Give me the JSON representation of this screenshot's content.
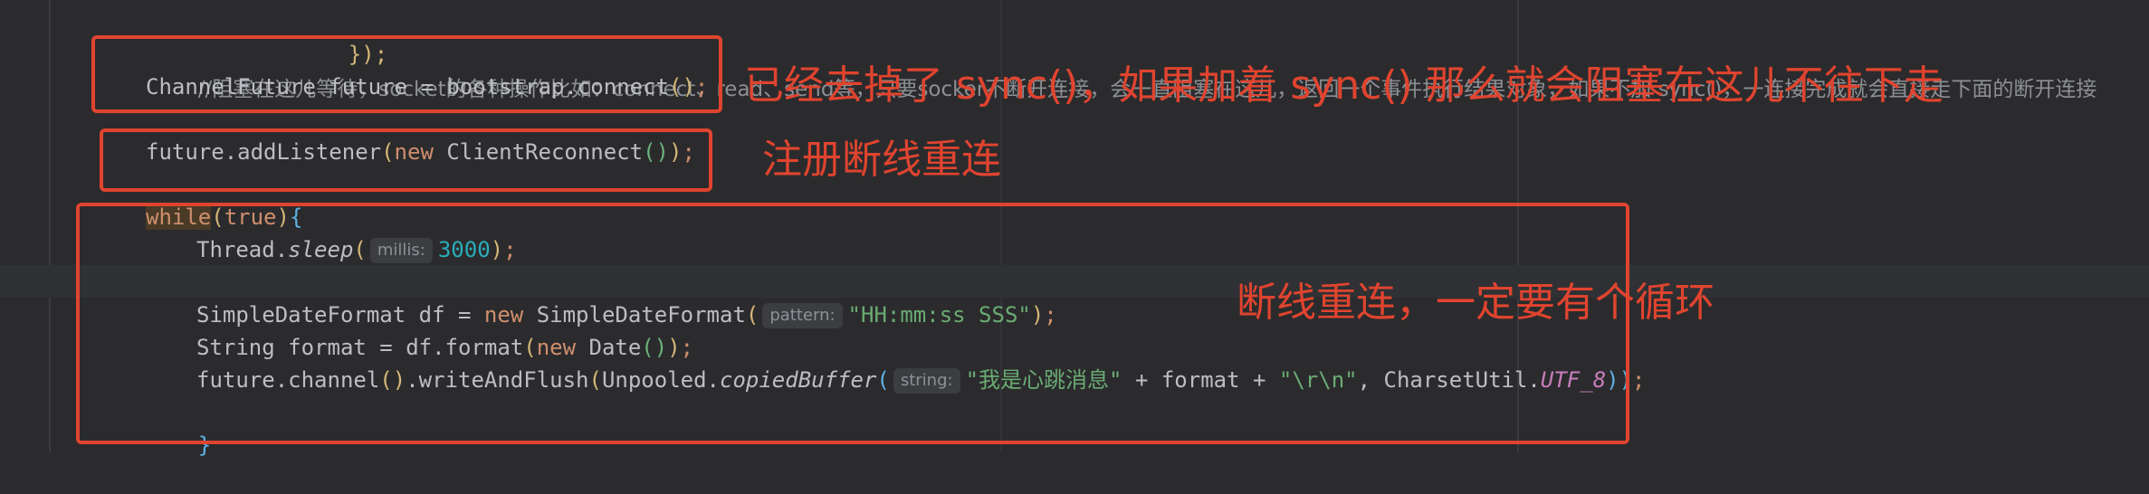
{
  "editor": {
    "top_brace": "});",
    "comment": "//阻塞在这儿等待，socket的各种操作比如：connect、read、send等，只要socker不断开连接，会一直阻塞在这儿，返回一个事件执行结果对象，如果不加 sync()，一连接完成就会直接走下面的断开连接",
    "line_connect": {
      "type": "ChannelFuture",
      "var": "future",
      "eq": " = ",
      "call": "bootstrap.connect",
      "paren": "()",
      "semi": ";"
    },
    "line_listener": {
      "call": "future.addListener",
      "open": "(",
      "kw_new": "new",
      "cls": " ClientReconnect",
      "inner": "()",
      "close": ")",
      "semi": ";"
    },
    "line_while": {
      "kw": "while",
      "open": "(",
      "val": "true",
      "close": ")",
      "brace": "{"
    },
    "line_sleep": {
      "prefix": "Thread.",
      "method": "sleep",
      "open": "(",
      "hint": "millis:",
      "value": "3000",
      "close": ")",
      "semi": ";"
    },
    "line_sdf": {
      "decl": "SimpleDateFormat df = ",
      "kw_new": "new",
      "cls": " SimpleDateFormat",
      "open": "(",
      "hint": "pattern:",
      "value": "\"HH:mm:ss SSS\"",
      "close": ")",
      "semi": ";"
    },
    "line_format": {
      "decl": "String format = df.format",
      "open": "(",
      "kw_new": "new",
      "cls": " Date",
      "inner": "()",
      "close": ")",
      "semi": ";"
    },
    "line_write": {
      "obj": "future.channel",
      "p1": "()",
      "call": ".writeAndFlush",
      "open": "(",
      "cls": "Unpooled.",
      "method": "copiedBuffer",
      "open2": "(",
      "hint": "string:",
      "str1": "\"我是心跳消息\"",
      "plus1": " + format + ",
      "str2": "\"\\r\\n\"",
      "comma": ", CharsetUtil.",
      "field": "UTF_8",
      "close": "))",
      "semi": ";"
    },
    "close_brace": "}"
  },
  "annotations": {
    "sync_note": "已经去掉了 sync()，如果加着 sync() 那么就会阻塞在这儿不往下走",
    "register_note": "注册断线重连",
    "loop_note": "断线重连，一定要有个循环"
  },
  "colors": {
    "background": "#2b2b2d",
    "annotation_red": "#e0442f",
    "keyword": "#cf8e6d",
    "string": "#6aab73",
    "number": "#2aacb8",
    "comment": "#8c8f94"
  }
}
